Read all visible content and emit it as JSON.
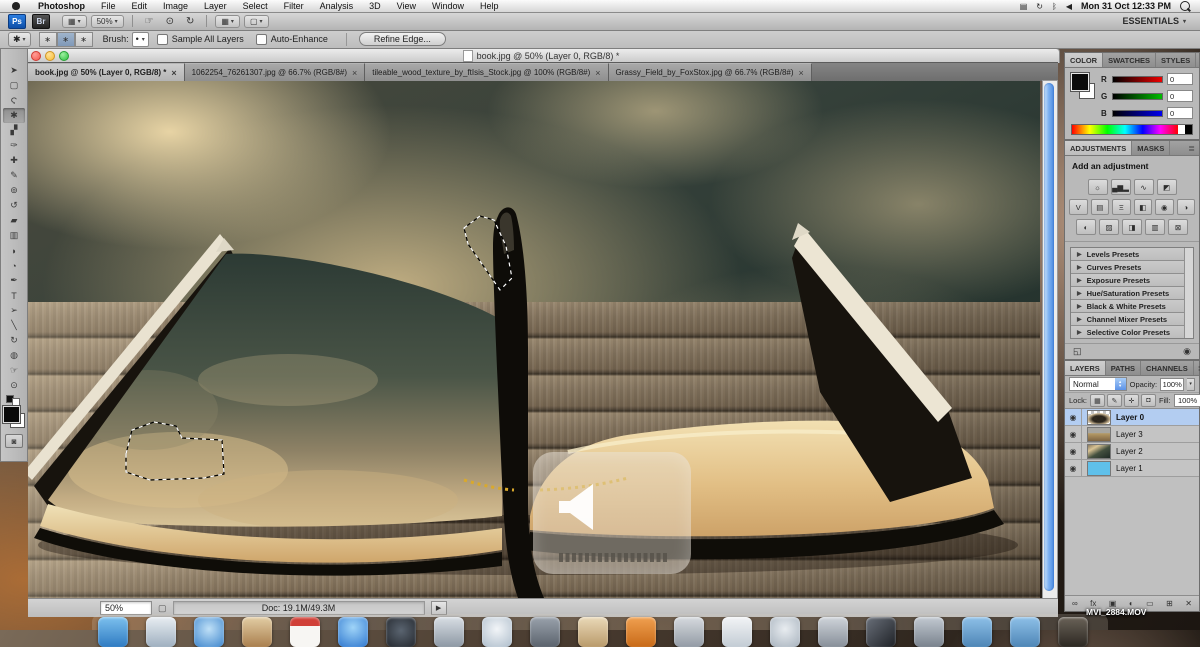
{
  "menubar": {
    "menus": [
      {
        "label": "Photoshop",
        "bold": true
      },
      {
        "label": "File"
      },
      {
        "label": "Edit"
      },
      {
        "label": "Image"
      },
      {
        "label": "Layer"
      },
      {
        "label": "Select"
      },
      {
        "label": "Filter"
      },
      {
        "label": "Analysis"
      },
      {
        "label": "3D"
      },
      {
        "label": "View"
      },
      {
        "label": "Window"
      },
      {
        "label": "Help"
      }
    ],
    "status_icons": [
      {
        "name": "display-icon",
        "glyph": "▤"
      },
      {
        "name": "time-machine-icon",
        "glyph": "↻"
      },
      {
        "name": "bluetooth-icon",
        "glyph": "ᛒ"
      },
      {
        "name": "volume-icon",
        "glyph": "◀"
      }
    ],
    "clock": "Mon 31 Oct 12:33 PM"
  },
  "app_bar": {
    "ps_badge": "Ps",
    "br_badge": "Br",
    "layout_icon": "▦",
    "zoom_level": "50%",
    "hand_icon": "☞",
    "zoom_icon": "⊙",
    "rotate_icon": "↻",
    "arrange_icon": "▦",
    "screen_mode_icon": "▢",
    "workspace": "ESSENTIALS"
  },
  "options_bar": {
    "tool_icon": "✱",
    "mode_icons": [
      {
        "name": "new-selection-icon",
        "glyph": "∗",
        "active": false
      },
      {
        "name": "add-to-selection-icon",
        "glyph": "∗",
        "active": true
      },
      {
        "name": "subtract-from-selection-icon",
        "glyph": "∗",
        "active": false
      }
    ],
    "brush_label": "Brush:",
    "brush_preview": "•",
    "checkboxes": [
      "Sample All Layers",
      "Auto-Enhance"
    ],
    "refine_edge_label": "Refine Edge..."
  },
  "window": {
    "title": "book.jpg @ 50% (Layer 0, RGB/8) *",
    "tab_close": "×",
    "tabs": [
      {
        "label": "book.jpg @ 50% (Layer 0, RGB/8) *",
        "active": true
      },
      {
        "label": "1062254_76261307.jpg @ 66.7% (RGB/8#)",
        "active": false
      },
      {
        "label": "tileable_wood_texture_by_ftIsis_Stock.jpg @ 100% (RGB/8#)",
        "active": false
      },
      {
        "label": "Grassy_Field_by_FoxStox.jpg @ 66.7% (RGB/8#)",
        "active": false
      }
    ]
  },
  "tools": [
    {
      "name": "move-tool",
      "glyph": "➤",
      "active": false
    },
    {
      "name": "marquee-tool",
      "glyph": "▢",
      "active": false
    },
    {
      "name": "lasso-tool",
      "glyph": "Ϛ",
      "active": false
    },
    {
      "name": "quick-selection-tool",
      "glyph": "✱",
      "active": true
    },
    {
      "name": "crop-tool",
      "glyph": "▞",
      "active": false
    },
    {
      "name": "eyedropper-tool",
      "glyph": "✑",
      "active": false
    },
    {
      "name": "healing-brush-tool",
      "glyph": "✚",
      "active": false
    },
    {
      "name": "brush-tool",
      "glyph": "✎",
      "active": false
    },
    {
      "name": "clone-stamp-tool",
      "glyph": "⊚",
      "active": false
    },
    {
      "name": "history-brush-tool",
      "glyph": "↺",
      "active": false
    },
    {
      "name": "eraser-tool",
      "glyph": "▰",
      "active": false
    },
    {
      "name": "gradient-tool",
      "glyph": "▥",
      "active": false
    },
    {
      "name": "blur-tool",
      "glyph": "◗",
      "active": false
    },
    {
      "name": "dodge-tool",
      "glyph": "◔",
      "active": false
    },
    {
      "name": "pen-tool",
      "glyph": "✒",
      "active": false
    },
    {
      "name": "type-tool",
      "glyph": "T",
      "active": false
    },
    {
      "name": "path-selection-tool",
      "glyph": "➢",
      "active": false
    },
    {
      "name": "line-shape-tool",
      "glyph": "╲",
      "active": false
    },
    {
      "name": "3d-rotate-tool",
      "glyph": "↻",
      "active": false
    },
    {
      "name": "3d-orbit-tool",
      "glyph": "◍",
      "active": false
    },
    {
      "name": "hand-tool",
      "glyph": "☞",
      "active": false
    },
    {
      "name": "zoom-tool",
      "glyph": "⊙",
      "active": false
    }
  ],
  "status_bar": {
    "zoom": "50%",
    "page_icon": "▢",
    "doc": "Doc: 19.1M/49.3M",
    "arrow": "▶"
  },
  "panels": {
    "color": {
      "tabs": [
        {
          "label": "COLOR",
          "active": true
        },
        {
          "label": "SWATCHES",
          "active": false
        },
        {
          "label": "STYLES",
          "active": false
        }
      ],
      "menu_icon": "≣",
      "channels": [
        {
          "label": "R",
          "value": "0",
          "track": "background:linear-gradient(90deg,#000,#e00)"
        },
        {
          "label": "G",
          "value": "0",
          "track": "background:linear-gradient(90deg,#000,#0b0)"
        },
        {
          "label": "B",
          "value": "0",
          "track": "background:linear-gradient(90deg,#000,#00e)"
        }
      ]
    },
    "adjustments": {
      "tabs": [
        {
          "label": "ADJUSTMENTS",
          "active": true
        },
        {
          "label": "MASKS",
          "active": false
        }
      ],
      "menu_icon": "≣",
      "heading": "Add an adjustment",
      "row1": [
        {
          "name": "brightness-contrast-icon",
          "glyph": "☼"
        },
        {
          "name": "levels-icon",
          "glyph": "▄▆▂"
        },
        {
          "name": "curves-icon",
          "glyph": "∿"
        },
        {
          "name": "exposure-icon",
          "glyph": "◩"
        }
      ],
      "row2": [
        {
          "name": "vibrance-icon",
          "glyph": "V"
        },
        {
          "name": "hue-saturation-icon",
          "glyph": "▤"
        },
        {
          "name": "color-balance-icon",
          "glyph": "Ξ"
        },
        {
          "name": "black-white-icon",
          "glyph": "◧"
        },
        {
          "name": "photo-filter-icon",
          "glyph": "◉"
        },
        {
          "name": "channel-mixer-icon",
          "glyph": "◑"
        }
      ],
      "row3": [
        {
          "name": "invert-icon",
          "glyph": "◐"
        },
        {
          "name": "posterize-icon",
          "glyph": "▨"
        },
        {
          "name": "threshold-icon",
          "glyph": "◨"
        },
        {
          "name": "gradient-map-icon",
          "glyph": "▥"
        },
        {
          "name": "selective-color-icon",
          "glyph": "⊠"
        }
      ],
      "preset_arrow": "▶",
      "presets": [
        "Levels Presets",
        "Curves Presets",
        "Exposure Presets",
        "Hue/Saturation Presets",
        "Black & White Presets",
        "Channel Mixer Presets",
        "Selective Color Presets"
      ],
      "footer_icons": [
        {
          "name": "switch-panel-view-icon",
          "glyph": "◱"
        },
        {
          "name": "clip-to-layer-icon",
          "glyph": "◉"
        }
      ]
    },
    "layers": {
      "tabs": [
        {
          "label": "LAYERS",
          "active": true
        },
        {
          "label": "PATHS",
          "active": false
        },
        {
          "label": "CHANNELS",
          "active": false
        }
      ],
      "menu_icon": "≣",
      "blend_mode": "Normal",
      "opacity_label": "Opacity:",
      "opacity_value": "100%",
      "lock_label": "Lock:",
      "fill_label": "Fill:",
      "fill_value": "100%",
      "lock_icons": [
        {
          "name": "lock-transparency-icon",
          "glyph": "▦"
        },
        {
          "name": "lock-pixels-icon",
          "glyph": "✎"
        },
        {
          "name": "lock-position-icon",
          "glyph": "✛"
        },
        {
          "name": "lock-all-icon",
          "glyph": "◘"
        }
      ],
      "eye_glyph": "◉",
      "items": [
        {
          "label": "Layer 0",
          "selected": true,
          "thumb_style": "background-image:radial-gradient(ellipse 16px 8px at 50% 62%,rgba(35,28,18,.95) 40%,rgba(210,188,148,.95) 70%,rgba(0,0,0,0) 78%),linear-gradient(45deg,#c4c4c4 25%,rgba(0,0,0,0) 25%,rgba(0,0,0,0) 75%,#c4c4c4 75%),linear-gradient(45deg,#c4c4c4 25%,#fff 25%,#fff 75%,#c4c4c4 75%);background-size:100% 100%,6px 6px,6px 6px;background-position:0 0,0 0,3px 3px"
        },
        {
          "label": "Layer 3",
          "selected": false,
          "thumb_style": "background:linear-gradient(180deg,#a8a6a0 0%,#a8a6a0 38%,#b59a66 42%,#7e6442 100%)"
        },
        {
          "label": "Layer 2",
          "selected": false,
          "thumb_style": "background:linear-gradient(150deg,#8a7a5e 0%,#d9c394 25%,#44503f 55%,#202b26 100%)"
        },
        {
          "label": "Layer 1",
          "selected": false,
          "thumb_style": "background:#5fc0ea"
        }
      ],
      "footer_icons": [
        {
          "name": "link-layers-icon",
          "glyph": "∞"
        },
        {
          "name": "layer-effects-icon",
          "glyph": "fx"
        },
        {
          "name": "add-layer-mask-icon",
          "glyph": "▣"
        },
        {
          "name": "new-adjustment-layer-icon",
          "glyph": "◐"
        },
        {
          "name": "new-group-icon",
          "glyph": "▭"
        },
        {
          "name": "new-layer-icon",
          "glyph": "⊞"
        },
        {
          "name": "delete-layer-icon",
          "glyph": "✕"
        }
      ]
    }
  },
  "desktop": {
    "file_label": "MVI_2884.MOV",
    "dock_icons": [
      {
        "name": "finder-dock-icon",
        "style": "background:linear-gradient(180deg,#7cc0ee,#2f7bc2)"
      },
      {
        "name": "mail-dock-icon",
        "style": "background:linear-gradient(180deg,#e8edf2,#9fb0c0)"
      },
      {
        "name": "safari-dock-icon",
        "style": "background:radial-gradient(circle at 50% 40%,#bfe0f7,#3d85cc)"
      },
      {
        "name": "address-book-dock-icon",
        "style": "background:linear-gradient(180deg,#e3cda4,#a97f4e)"
      },
      {
        "name": "ical-dock-icon",
        "style": "background:linear-gradient(180deg,#d04038 0 30%,#f7f6f3 30%)"
      },
      {
        "name": "ichat-dock-icon",
        "style": "background:radial-gradient(circle at 50% 35%,#9fd4f8,#2e77cf)"
      },
      {
        "name": "imovie-dock-icon",
        "style": "background:radial-gradient(circle at 50% 45%,#5a6470,#23272d)"
      },
      {
        "name": "photo-booth-dock-icon",
        "style": "background:linear-gradient(180deg,#d8dee4,#8d98a4)"
      },
      {
        "name": "itunes-dock-icon",
        "style": "background:radial-gradient(circle at 50% 40%,#f2f5f8,#aebdcb)"
      },
      {
        "name": "dvd-player-dock-icon",
        "style": "background:linear-gradient(180deg,#9aa2ac,#5b636d)"
      },
      {
        "name": "iphoto-dock-icon",
        "style": "background:linear-gradient(180deg,#ead9b8,#b99a6a)"
      },
      {
        "name": "app-orange-dock-icon",
        "style": "background:linear-gradient(180deg,#f0a050,#c86a18)"
      },
      {
        "name": "utilities-dock-icon",
        "style": "background:linear-gradient(180deg,#d6dade,#939ba5)"
      },
      {
        "name": "ink-pen-dock-icon",
        "style": "background:linear-gradient(180deg,#f2f4f6,#c3ccd4)"
      },
      {
        "name": "grapher-dock-icon",
        "style": "background:radial-gradient(circle at 50% 40%,#e8ecf0,#a7b2bd)"
      },
      {
        "name": "keyboard-dock-icon",
        "style": "background:linear-gradient(180deg,#cfd4da,#878f99)"
      },
      {
        "name": "clapper-dock-icon",
        "style": "background:linear-gradient(135deg,#6a707a,#1e2126)"
      },
      {
        "name": "textedit-dock-icon",
        "style": "background:linear-gradient(180deg,#c2c9d1,#79828d)"
      },
      {
        "name": "folder-dock-icon",
        "style": "background:linear-gradient(180deg,#8ec0e8,#4e86b6)"
      },
      {
        "name": "folder-dock-icon",
        "style": "background:linear-gradient(180deg,#8ec0e8,#4e86b6)"
      },
      {
        "name": "camera-dock-icon",
        "style": "background:linear-gradient(180deg,#6a6258,#2c2822)"
      }
    ]
  },
  "colors": {
    "selection_highlight": "#b3cdf1",
    "aqua_scrollbar": "#7fb2f2",
    "sky_dark_teal": "#273530",
    "cloud_gold": "#e0c795",
    "page_tan": "#d6ae74",
    "cover_black": "#17130d"
  }
}
